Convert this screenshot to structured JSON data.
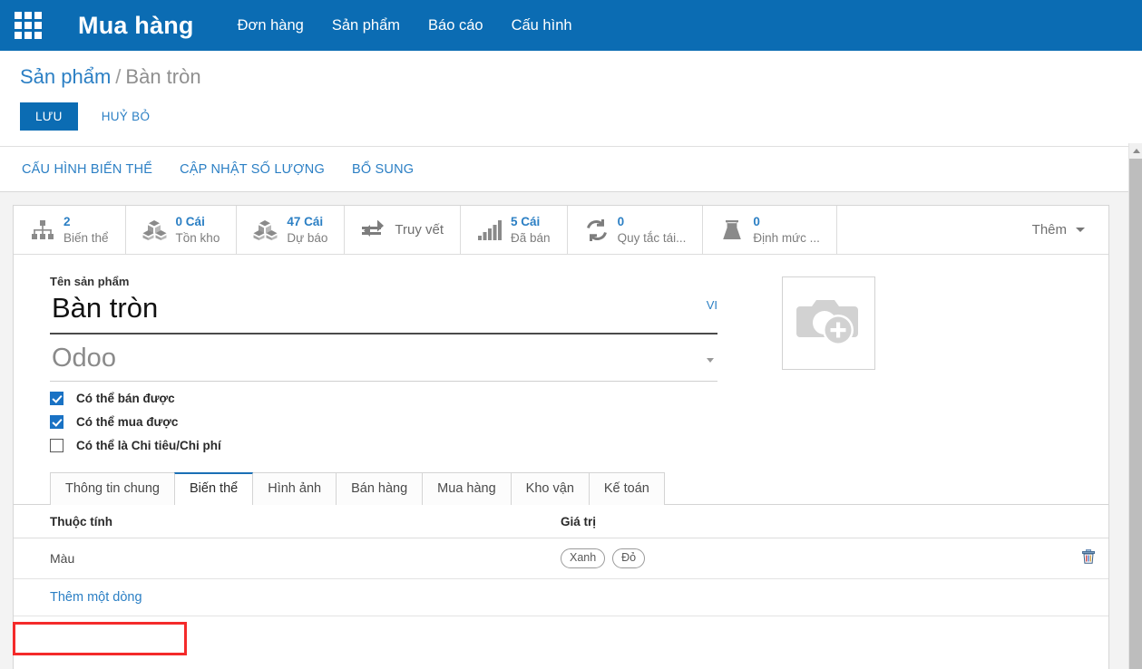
{
  "navbar": {
    "apps_icon": "apps-grid-icon",
    "app_title": "Mua hàng",
    "menu": [
      {
        "label": "Đơn hàng"
      },
      {
        "label": "Sản phẩm"
      },
      {
        "label": "Báo cáo"
      },
      {
        "label": "Cấu hình"
      }
    ],
    "bg_color": "#0b6cb3"
  },
  "control_panel": {
    "breadcrumb_root": "Sản phẩm",
    "breadcrumb_sep": "/",
    "breadcrumb_current": "Bàn tròn",
    "save_label": "LƯU",
    "discard_label": "HUỶ BỎ",
    "accent_color": "#0b6cb3"
  },
  "action_bar": {
    "buttons": [
      {
        "label": "CẤU HÌNH BIẾN THỂ"
      },
      {
        "label": "CẬP NHẬT SỐ LƯỢNG"
      },
      {
        "label": "BỔ SUNG"
      }
    ]
  },
  "stat_buttons": [
    {
      "icon": "hierarchy-icon",
      "value": "2",
      "label": "Biến thể"
    },
    {
      "icon": "boxes-icon",
      "value": "0 Cái",
      "label": "Tồn kho"
    },
    {
      "icon": "boxes-icon",
      "value": "47 Cái",
      "label": "Dự báo"
    },
    {
      "icon": "exchange-icon",
      "value": "",
      "label": "Truy vết"
    },
    {
      "icon": "bar-chart-icon",
      "value": "5 Cái",
      "label": "Đã bán"
    },
    {
      "icon": "refresh-icon",
      "value": "0",
      "label": "Quy tắc tái..."
    },
    {
      "icon": "flask-icon",
      "value": "0",
      "label": "Định mức ..."
    }
  ],
  "stat_more": {
    "label": "Thêm",
    "icon": "chevron-down-icon"
  },
  "form": {
    "product_name_label": "Tên sản phẩm",
    "product_name_value": "Bàn tròn",
    "lang_badge": "VI",
    "company_value": "Odoo",
    "image_placeholder_icon": "camera-add-icon",
    "checkboxes": [
      {
        "label": "Có thể bán được",
        "checked": true
      },
      {
        "label": "Có thể mua được",
        "checked": true
      },
      {
        "label": "Có thể là Chi tiêu/Chi phí",
        "checked": false
      }
    ]
  },
  "notebook": {
    "tabs": [
      {
        "label": "Thông tin chung",
        "active": false
      },
      {
        "label": "Biến thể",
        "active": true
      },
      {
        "label": "Hình ảnh",
        "active": false
      },
      {
        "label": "Bán hàng",
        "active": false
      },
      {
        "label": "Mua hàng",
        "active": false
      },
      {
        "label": "Kho vận",
        "active": false
      },
      {
        "label": "Kế toán",
        "active": false
      }
    ]
  },
  "attributes_table": {
    "headers": {
      "attribute": "Thuộc tính",
      "value": "Giá trị"
    },
    "rows": [
      {
        "attribute": "Màu",
        "values": [
          "Xanh",
          "Đỏ"
        ],
        "delete_icon": "trash-icon"
      }
    ],
    "add_line_label": "Thêm một dòng"
  },
  "annotation": {
    "highlight_color": "#f42a2a"
  },
  "scrollbar": {
    "up_arrow_icon": "caret-up-icon"
  }
}
